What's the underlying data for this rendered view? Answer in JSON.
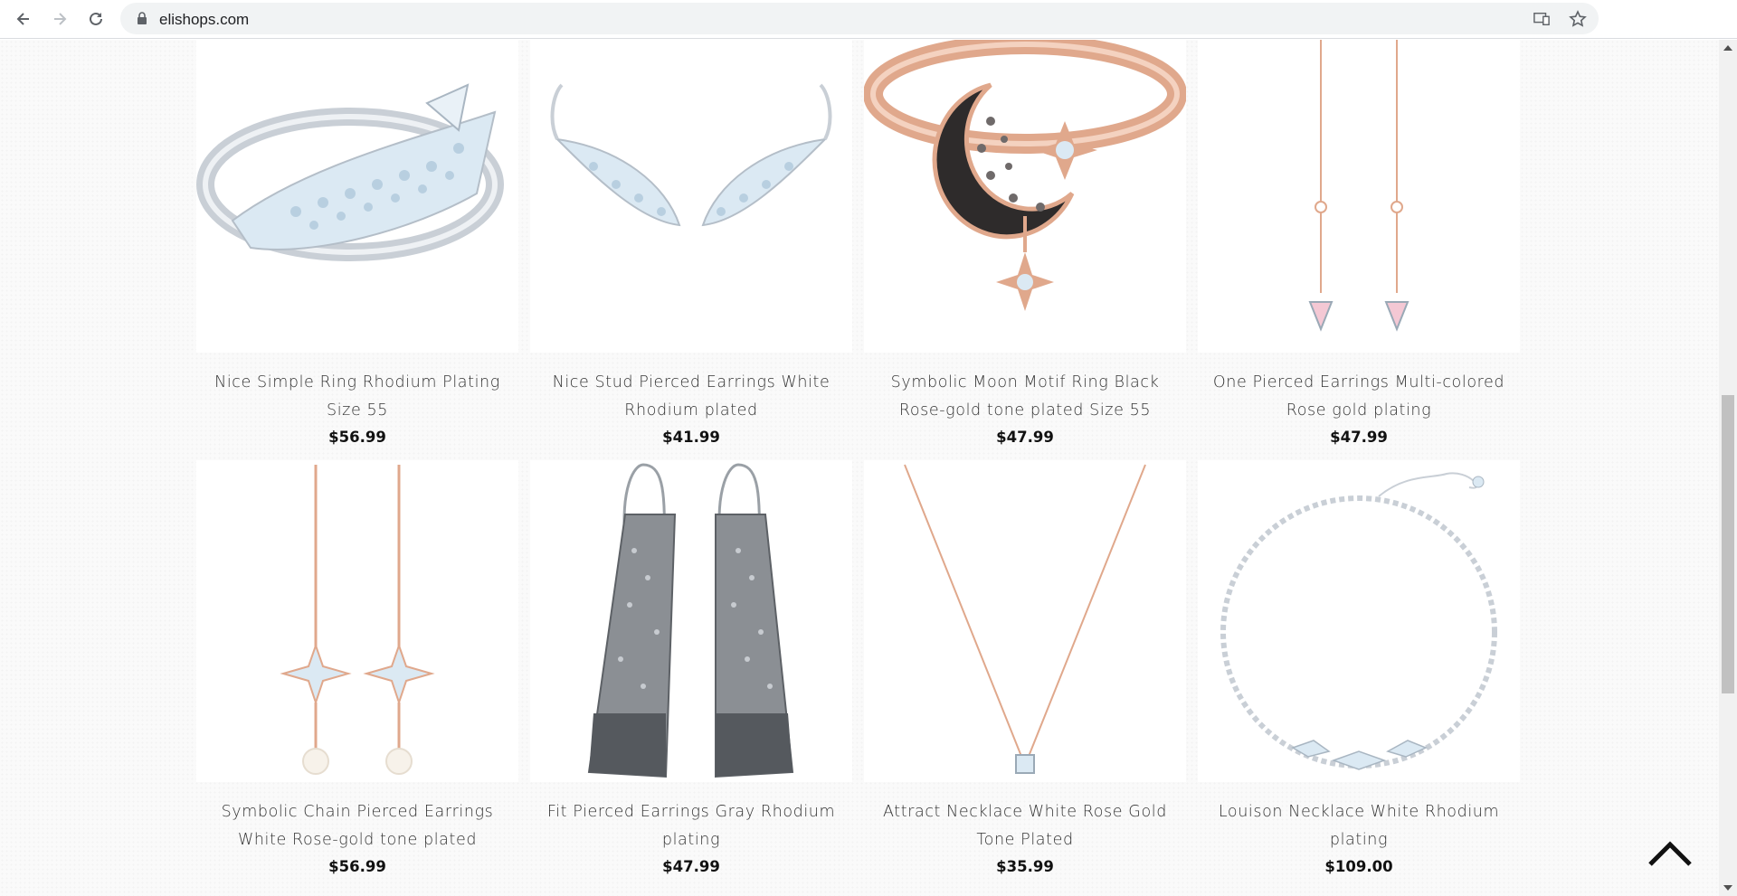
{
  "browser": {
    "url": "elishops.com",
    "icons": {
      "back": "arrow-left-icon",
      "forward": "arrow-right-icon",
      "reload": "reload-icon",
      "lock": "lock-icon",
      "cast": "cast-icon",
      "bookmark": "star-icon"
    }
  },
  "products": [
    {
      "name": "Nice Simple Ring Rhodium Plating Size 55",
      "price": "$56.99",
      "image": "silver-feather-ring"
    },
    {
      "name": "Nice Stud Pierced Earrings White Rhodium plated",
      "price": "$41.99",
      "image": "silver-feather-earrings"
    },
    {
      "name": "Symbolic Moon Motif Ring Black Rose-gold tone plated Size 55",
      "price": "$47.99",
      "image": "rose-gold-moon-ring"
    },
    {
      "name": "One Pierced Earrings Multi-colored Rose gold plating",
      "price": "$47.99",
      "image": "rose-gold-drop-earrings"
    },
    {
      "name": "Symbolic Chain Pierced Earrings White Rose-gold tone plated",
      "price": "$56.99",
      "image": "star-pearl-chain-earrings"
    },
    {
      "name": "Fit Pierced Earrings Gray Rhodium plating",
      "price": "$47.99",
      "image": "gray-mesh-earrings"
    },
    {
      "name": "Attract Necklace White Rose Gold Tone Plated",
      "price": "$35.99",
      "image": "rose-gold-pendant-necklace"
    },
    {
      "name": "Louison Necklace White Rhodium plating",
      "price": "$109.00",
      "image": "silver-crystal-necklace"
    }
  ],
  "back_to_top": {
    "icon": "chevron-up-icon"
  },
  "colors": {
    "rose_gold": "#e0a88c",
    "silver": "#c9cfd6",
    "crystal": "#dbe9f3",
    "page_bg": "#fafafa"
  }
}
